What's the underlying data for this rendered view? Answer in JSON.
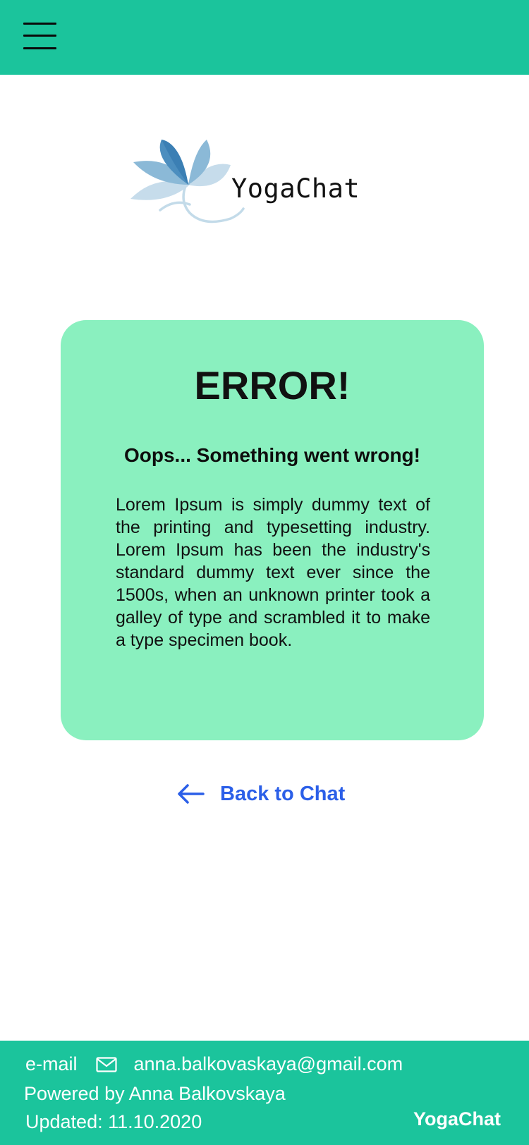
{
  "header": {
    "menu_icon": "hamburger-menu-icon",
    "background_color": "#1bc49c"
  },
  "logo": {
    "icon": "lotus-flower-icon",
    "text": "YogaChat"
  },
  "error_card": {
    "title": "ERROR!",
    "subtitle": "Oops... Something went wrong!",
    "body": "Lorem Ipsum is simply dummy text of the printing and typesetting industry. Lorem Ipsum has been the industry's standard dummy text ever since the 1500s, when an unknown printer took a galley of type and scrambled it to make a type specimen book.",
    "background_color": "#8af0bf"
  },
  "back_link": {
    "icon": "arrow-left-icon",
    "label": "Back to Chat",
    "color": "#2b5fe8"
  },
  "footer": {
    "email_label": "e-mail",
    "email_icon": "envelope-icon",
    "email": "anna.balkovaskaya@gmail.com",
    "powered_by": "Powered by Anna Balkovskaya",
    "updated": "Updated: 11.10.2020",
    "brand": "YogaChat",
    "background_color": "#1bc49c"
  }
}
